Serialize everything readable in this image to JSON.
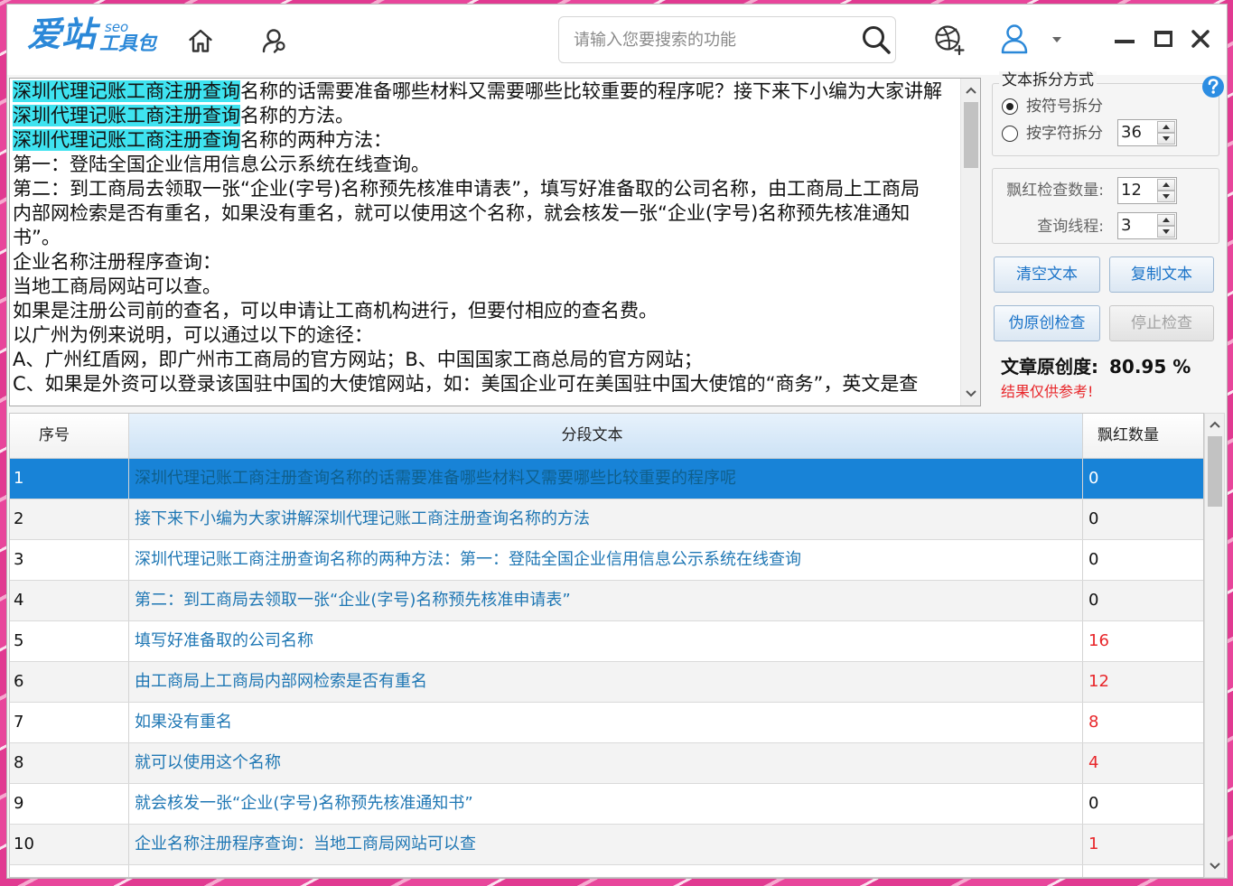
{
  "app": {
    "logo_main": "爱站",
    "logo_seo": "seo",
    "logo_sub": "工具包"
  },
  "header": {
    "search_placeholder": "请输入您要搜索的功能"
  },
  "icons": {
    "home": "home-icon",
    "user_search": "user-search-icon",
    "search": "search-icon",
    "basketball": "basketball-icon",
    "user": "user-icon",
    "dropdown": "chevron-down-icon",
    "minimize": "minimize-icon",
    "maximize": "maximize-icon",
    "close": "close-icon",
    "help": "help-icon"
  },
  "colors": {
    "brand_blue": "#2b88d8",
    "button_text": "#1a73c8",
    "keyword_highlight": "#3fe3f0",
    "selected_row": "#1883d7",
    "warning_red": "#e8262a",
    "segment_text": "#1f77b4"
  },
  "editor": {
    "keyword": "深圳代理记账工商注册查询",
    "lines": [
      {
        "hl": true,
        "text": "名称的话需要准备哪些材料又需要哪些比较重要的程序呢？接下来下小编为大家讲解"
      },
      {
        "hl": true,
        "text": "名称的方法。"
      },
      {
        "hl": true,
        "text": "名称的两种方法："
      },
      {
        "hl": false,
        "text": "第一：登陆全国企业信用信息公示系统在线查询。"
      },
      {
        "hl": false,
        "text": "第二：到工商局去领取一张“企业(字号)名称预先核准申请表”，填写好准备取的公司名称，由工商局上工商局"
      },
      {
        "hl": false,
        "text": "内部网检索是否有重名，如果没有重名，就可以使用这个名称，就会核发一张“企业(字号)名称预先核准通知"
      },
      {
        "hl": false,
        "text": "书”。"
      },
      {
        "hl": false,
        "text": "企业名称注册程序查询："
      },
      {
        "hl": false,
        "text": "当地工商局网站可以查。"
      },
      {
        "hl": false,
        "text": "如果是注册公司前的查名，可以申请让工商机构进行，但要付相应的查名费。"
      },
      {
        "hl": false,
        "text": "以广州为例来说明，可以通过以下的途径："
      },
      {
        "hl": false,
        "text": "A、广州红盾网，即广州市工商局的官方网站；B、中国国家工商总局的官方网站；"
      },
      {
        "hl": false,
        "text": "C、如果是外资可以登录该国驻中国的大使馆网站，如：美国企业可在美国驻中国大使馆的“商务”，英文是查"
      }
    ]
  },
  "options": {
    "split_title": "文本拆分方式",
    "split_by_symbol": "按符号拆分",
    "split_by_char": "按字符拆分",
    "split_by_symbol_checked": true,
    "char_count": "36",
    "red_check_label": "飘红检查数量:",
    "red_check_value": "12",
    "threads_label": "查询线程:",
    "threads_value": "3"
  },
  "buttons": {
    "clear": "清空文本",
    "copy": "复制文本",
    "check": "伪原创检查",
    "stop": "停止检查",
    "stop_disabled": true
  },
  "result": {
    "label": "文章原创度:",
    "value": "80.95 %",
    "note": "结果仅供参考!"
  },
  "table": {
    "headers": [
      "序号",
      "分段文本",
      "飘红数量"
    ],
    "selected_row": 1,
    "rows": [
      {
        "no": "1",
        "text": "深圳代理记账工商注册查询名称的话需要准备哪些材料又需要哪些比较重要的程序呢",
        "count": "0"
      },
      {
        "no": "2",
        "text": "接下来下小编为大家讲解深圳代理记账工商注册查询名称的方法",
        "count": "0"
      },
      {
        "no": "3",
        "text": "深圳代理记账工商注册查询名称的两种方法：第一：登陆全国企业信用信息公示系统在线查询",
        "count": "0"
      },
      {
        "no": "4",
        "text": "第二：到工商局去领取一张“企业(字号)名称预先核准申请表”",
        "count": "0"
      },
      {
        "no": "5",
        "text": "填写好准备取的公司名称",
        "count": "16"
      },
      {
        "no": "6",
        "text": "由工商局上工商局内部网检索是否有重名",
        "count": "12"
      },
      {
        "no": "7",
        "text": "如果没有重名",
        "count": "8"
      },
      {
        "no": "8",
        "text": "就可以使用这个名称",
        "count": "4"
      },
      {
        "no": "9",
        "text": "就会核发一张“企业(字号)名称预先核准通知书”",
        "count": "0"
      },
      {
        "no": "10",
        "text": "企业名称注册程序查询：当地工商局网站可以查",
        "count": "1"
      }
    ]
  }
}
